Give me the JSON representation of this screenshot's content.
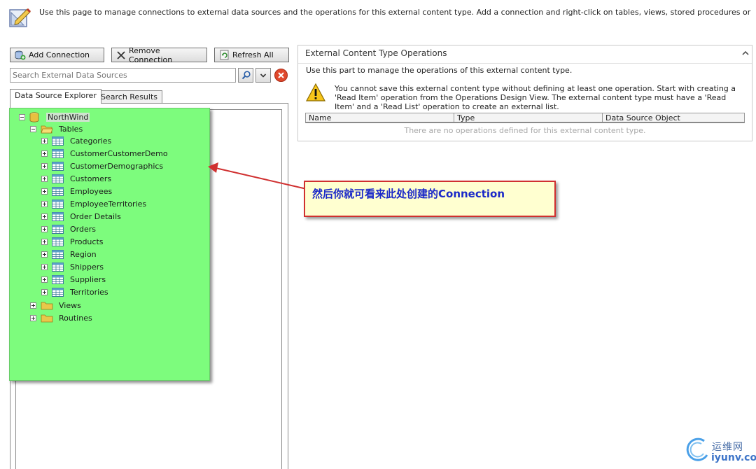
{
  "header": {
    "description": "Use this page to manage connections to external data sources and the operations for this external content type. Add a connection and right-click on tables, views, stored procedures or methods in",
    "icon": "pencil-ruler-icon"
  },
  "toolbar": {
    "add_label": "Add Connection",
    "remove_label": "Remove Connection",
    "refresh_label": "Refresh All"
  },
  "search": {
    "placeholder": "Search External Data Sources",
    "value": ""
  },
  "tabs": {
    "explorer": "Data Source Explorer",
    "results": "Search Results"
  },
  "tree": {
    "root": "NorthWind",
    "tables_label": "Tables",
    "tables": [
      "Categories",
      "CustomerCustomerDemo",
      "CustomerDemographics",
      "Customers",
      "Employees",
      "EmployeeTerritories",
      "Order Details",
      "Orders",
      "Products",
      "Region",
      "Shippers",
      "Suppliers",
      "Territories"
    ],
    "views_label": "Views",
    "routines_label": "Routines"
  },
  "operations": {
    "title": "External Content Type Operations",
    "description": "Use this part to manage the operations of this external content type.",
    "warning": "You cannot save this external content type without defining at least one operation. Start with creating a 'Read Item' operation from the Operations Design View. The external content type must have a 'Read Item' and a 'Read List' operation to create an external list.",
    "columns": [
      "Name",
      "Type",
      "Data Source Object"
    ],
    "empty_text": "There are no operations defined for this external content type."
  },
  "callout": {
    "text": "然后你就可看来此处创建的Connection"
  },
  "watermark": {
    "top": "运维网",
    "bottom": "iyunv.com"
  },
  "colors": {
    "highlight": "#7dfc7d",
    "callout_border": "#d03030",
    "callout_bg": "#ffffd0",
    "callout_text": "#1a28c8"
  }
}
